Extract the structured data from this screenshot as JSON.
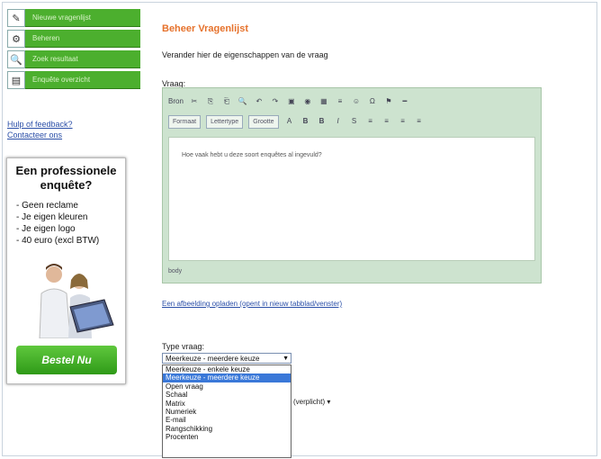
{
  "nav": {
    "items": [
      {
        "icon": "✎",
        "label": "Nieuwe vragenlijst"
      },
      {
        "icon": "⚙",
        "label": "Beheren"
      },
      {
        "icon": "🔍",
        "label": "Zoek resultaat"
      },
      {
        "icon": "▤",
        "label": "Enquête overzicht"
      }
    ]
  },
  "links": [
    "Hulp of feedback?",
    "Contacteer ons"
  ],
  "ad": {
    "title": "Een professionele enquête?",
    "bullets": [
      "- Geen reclame",
      "- Je eigen kleuren",
      "- Je eigen logo",
      "- 40 euro (excl BTW)"
    ],
    "button": "Bestel Nu"
  },
  "main": {
    "title": "Beheer Vragenlijst",
    "intro": "Verander hier de eigenschappen van de vraag",
    "vraag_label": "Vraag:",
    "editor": {
      "toolbar_row1": [
        "Bron",
        "✂",
        "⎘",
        "⎗",
        "🔍",
        "↶",
        "↷",
        "▣",
        "◉",
        "▦",
        "≡",
        "☺",
        "Ω",
        "⚑",
        "━"
      ],
      "toolbar_row2_selects": [
        "Formaat",
        "Lettertype",
        "Grootte"
      ],
      "toolbar_row2_buttons": [
        "A",
        "B",
        "B",
        "I",
        "S",
        "≡",
        "≡",
        "≡",
        "≡"
      ],
      "content": "Hoe vaak hebt u deze soort enquêtes al ingevuld?",
      "status": "body"
    },
    "upload_link": "Een afbeelding opladen (opent in nieuw tabblad/venster)",
    "type_label": "Type vraag:",
    "type_selected": "Meerkeuze - meerdere keuze",
    "type_options": [
      "Meerkeuze - enkele keuze",
      "Meerkeuze - meerdere keuze",
      "Open vraag",
      "Schaal",
      "Matrix",
      "Numeriek",
      "E-mail",
      "Rangschikking",
      "Procenten"
    ],
    "selected_index": 1,
    "behind_text": "(verplicht) ▾"
  }
}
